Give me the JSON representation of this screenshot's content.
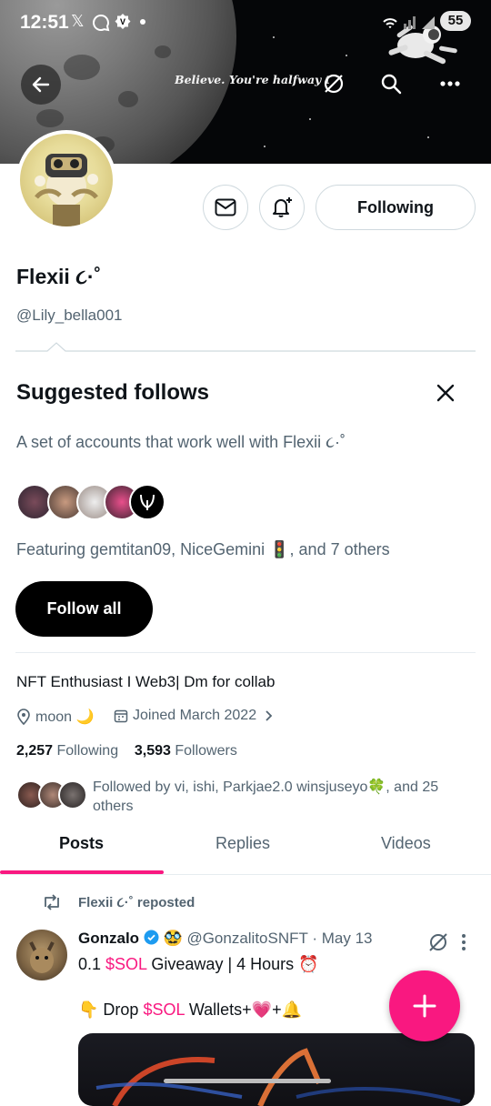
{
  "status_bar": {
    "time": "12:51",
    "battery": "55"
  },
  "banner": {
    "quote": "Believe. You're halfway the"
  },
  "profile": {
    "display_name": "Flexii ૮·˚",
    "handle": "@Lily_bella001",
    "following_button": "Following",
    "bio": "NFT Enthusiast I Web3| Dm for collab",
    "location": "moon 🌙",
    "joined": "Joined March 2022",
    "following_count": "2,257",
    "following_label": "Following",
    "followers_count": "3,593",
    "followers_label": "Followers",
    "followed_by": "Followed by vi, ishi, Parkjae2.0 winsjuseyo🍀, and 25 others"
  },
  "suggested": {
    "title": "Suggested follows",
    "description": "A set of accounts that work well with Flexii ૮·˚",
    "featuring": "Featuring gemtitan09, NiceGemini 🚦, and 7 others",
    "follow_all": "Follow all"
  },
  "tabs": [
    {
      "label": "Posts",
      "active": true
    },
    {
      "label": "Replies",
      "active": false
    },
    {
      "label": "Videos",
      "active": false
    }
  ],
  "post": {
    "repost_label": "Flexii ૮·˚ reposted",
    "author": "Gonzalo",
    "author_emoji": "🥸",
    "author_handle": "@GonzalitoSNFT",
    "separator": "·",
    "date": "May 13",
    "line1_prefix": "0.1 ",
    "line1_ticker": "$SOL",
    "line1_suffix": " Giveaway | 4 Hours ⏰",
    "line2_prefix": "👇 Drop ",
    "line2_ticker": "$SOL",
    "line2_suffix": " Wallets+💗+🔔"
  },
  "colors": {
    "accent": "#f91880",
    "verified": "#1d9bf0",
    "text_secondary": "#536471"
  },
  "icons": [
    "back-arrow-icon",
    "grok-icon",
    "search-icon",
    "more-icon",
    "mail-icon",
    "bell-plus-icon",
    "close-icon",
    "location-icon",
    "calendar-icon",
    "chevron-right-icon",
    "repost-icon",
    "verified-icon",
    "plus-icon"
  ]
}
